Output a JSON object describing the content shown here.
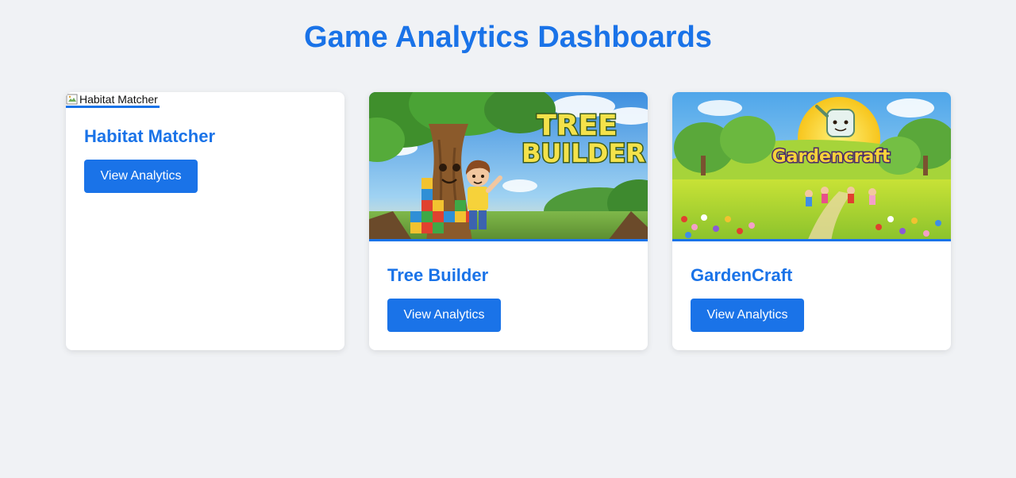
{
  "page": {
    "title": "Game Analytics Dashboards"
  },
  "games": [
    {
      "name": "Habitat Matcher",
      "image_alt": "Habitat Matcher",
      "button_label": "View Analytics"
    },
    {
      "name": "Tree Builder",
      "banner_text_line1": "TREE",
      "banner_text_line2": "BUILDER",
      "button_label": "View Analytics"
    },
    {
      "name": "GardenCraft",
      "banner_text": "Gardencraft",
      "button_label": "View Analytics"
    }
  ],
  "colors": {
    "accent": "#1a73e8",
    "background": "#f0f2f5",
    "card": "#ffffff"
  }
}
